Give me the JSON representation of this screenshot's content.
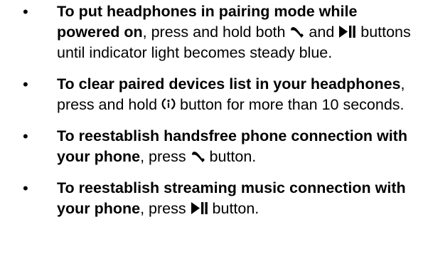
{
  "items": [
    {
      "lead": "To put headphones in pairing mode while powered on",
      "parts": [
        ", press and hold both ",
        " and ",
        " buttons until indicator light becomes steady blue."
      ],
      "icons": [
        "phone-icon",
        "play-pause-icon"
      ]
    },
    {
      "lead": "To clear paired devices list in your headphones",
      "parts": [
        ", press and hold ",
        " button for more than 10 seconds."
      ],
      "icons": [
        "power-icon"
      ]
    },
    {
      "lead": "To reestablish handsfree phone connection with your phone",
      "parts": [
        ", press ",
        " button."
      ],
      "icons": [
        "phone-icon"
      ]
    },
    {
      "lead": "To reestablish streaming music connection with your phone",
      "parts": [
        ", press ",
        " button."
      ],
      "icons": [
        "play-pause-icon"
      ]
    }
  ]
}
